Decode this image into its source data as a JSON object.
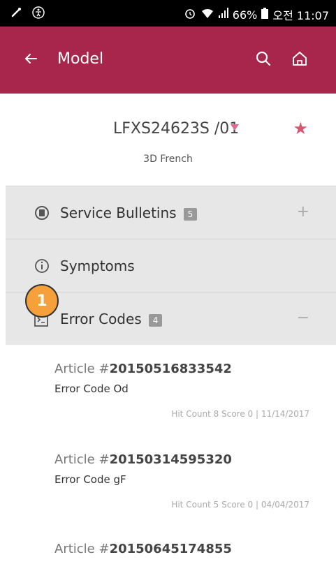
{
  "status_bar": {
    "battery": "66%",
    "time": "오전 11:07"
  },
  "header": {
    "back_icon": "arrow-left-icon",
    "title": "Model",
    "search_icon": "search-icon",
    "home_icon": "home-icon"
  },
  "model": {
    "number": "LFXS24623S /01",
    "subtitle": "3D French"
  },
  "sections": [
    {
      "label": "Service Bulletins",
      "badge": "5",
      "toggle": "+"
    },
    {
      "label": "Symptoms",
      "badge": "",
      "toggle": ""
    },
    {
      "label": "Error Codes",
      "badge": "4",
      "toggle": "−"
    }
  ],
  "step_marker": "1",
  "articles": [
    {
      "prefix": "Article #",
      "number": "20150516833542",
      "title": "Error Code Od",
      "meta": "Hit Count 8 Score 0  |  11/14/2017"
    },
    {
      "prefix": "Article #",
      "number": "20150314595320",
      "title": "Error Code gF",
      "meta": "Hit Count 5 Score 0  |  04/04/2017"
    },
    {
      "prefix": "Article #",
      "number": "20150645174855",
      "title": "",
      "meta": ""
    }
  ],
  "colors": {
    "brand": "#a8264b",
    "accent": "#d9546f",
    "marker": "#f5a03b"
  }
}
